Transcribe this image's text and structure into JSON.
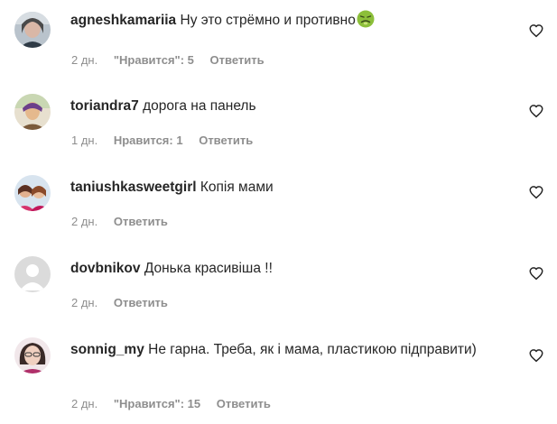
{
  "comments": [
    {
      "username": "agneshkamariia",
      "text": "Ну это стрёмно и противно",
      "emoji": "nauseated-face",
      "time": "2 дн.",
      "likes_label": "\"Нравится\": 5",
      "reply": "Ответить"
    },
    {
      "username": "toriandra7",
      "text": "дорога на панель",
      "time": "1 дн.",
      "likes_label": "Нравится: 1",
      "reply": "Ответить"
    },
    {
      "username": "taniushkasweetgirl",
      "text": "Копія мами",
      "time": "2 дн.",
      "reply": "Ответить"
    },
    {
      "username": "dovbnikov",
      "text": "Донька красивіша !!",
      "time": "2 дн.",
      "reply": "Ответить"
    },
    {
      "username": "sonnig_my",
      "text": "Не гарна. Треба, як і мама, пластикою підправити)",
      "time": "2 дн.",
      "likes_label": "\"Нравится\": 15",
      "reply": "Ответить"
    }
  ],
  "icons": {
    "like": "heart-outline-icon"
  },
  "colors": {
    "text": "#262626",
    "secondary": "#8e8e8e"
  }
}
